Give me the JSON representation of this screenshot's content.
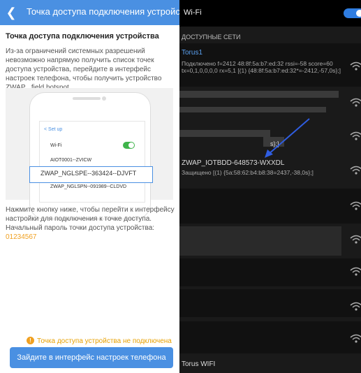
{
  "left": {
    "header_title": "Точка доступа подключения устройства",
    "section_title": "Точка доступа подключения устройства",
    "description": "Из-за ограничений системных разрешений невозможно напрямую получить список точек доступа устройства, перейдите в интерфейс настроек телефона, чтобы получить устройство ZWAP_ field hotspot",
    "illustration": {
      "setup": "< Set up",
      "wifi_label": "Wi-Fi",
      "ap1": "AIOT0001--ZVICW",
      "highlight_ap": "ZWAP_NGLSPE--363424--DJVFT",
      "ap3": "ZWAP_NGLSPN--091989--CLDVD"
    },
    "instruction": "Нажмите кнопку ниже, чтобы перейти к интерфейсу настройки для подключения к точке доступа.",
    "password_label": "Начальный пароль точки доступа устройства:",
    "password_value": "01234567",
    "status": "Точка доступа устройства не подключена",
    "button": "Зайдите в интерфейс настроек телефона"
  },
  "right": {
    "header_title": "Wi-Fi",
    "available": "ДОСТУПНЫЕ СЕТИ",
    "net1_name": "Torus1",
    "net1_sub": "Подключено f=2412  48:8f:5a:b7:ed:32 rssi=-58 score=60 tx=0,1,0,0,0,0 rx=5,1 [(1) {48:8f:5a:b7:ed:32*=-2412,-57,0s};]",
    "blur_suffix": "s};]",
    "net2_name": "ZWAP_IOTBDD-648573-WXXDL",
    "net2_sub": "Защищено  [(1) {5a:58:62:b4:b8:38=2437,-38,0s};]",
    "net_last": "Torus WIFI"
  },
  "colors": {
    "accent": "#4a90e2",
    "warning": "#f0a020",
    "toggle_on": "#3fb44b",
    "dark_accent": "#2f7de1"
  }
}
